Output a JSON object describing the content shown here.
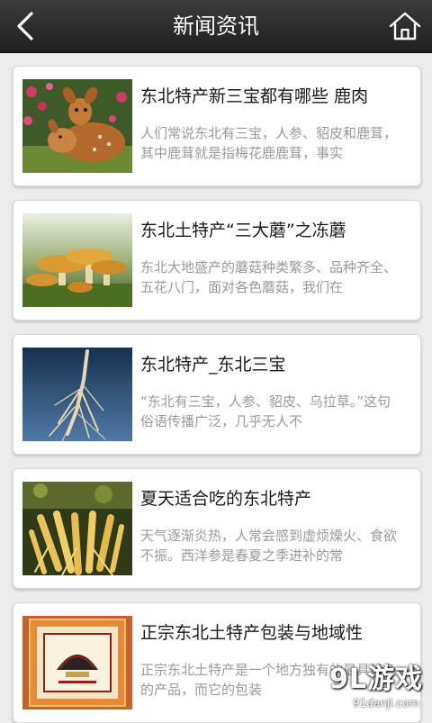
{
  "header": {
    "title": "新闻资讯",
    "back_icon": "back-arrow-icon",
    "home_icon": "home-icon"
  },
  "articles": [
    {
      "title": "东北特产新三宝都有哪些 鹿肉",
      "desc": "人们常说东北有三宝，人参、貂皮和鹿茸，其中鹿茸就是指梅花鹿鹿茸，事实"
    },
    {
      "title": "东北土特产“三大蘑”之冻蘑",
      "desc": "东北大地盛产的蘑菇种类繁多、品种齐全、五花八门，面对各色蘑菇，我们在"
    },
    {
      "title": "东北特产_东北三宝",
      "desc": "“东北有三宝，人参、貂皮、乌拉草。”这句俗语传播广泛，几乎无人不"
    },
    {
      "title": "夏天适合吃的东北特产",
      "desc": "天气逐渐炎热，人常会感到虚烦燥火、食欲不振。西洋参是春夏之季进补的常"
    },
    {
      "title": "正宗东北土特产包装与地域性",
      "desc": "正宗东北土特产是一个地方独有的最具特色的产品，而它的包装"
    }
  ],
  "watermark": {
    "logo": "9L游戏",
    "url": "91danji.com"
  }
}
